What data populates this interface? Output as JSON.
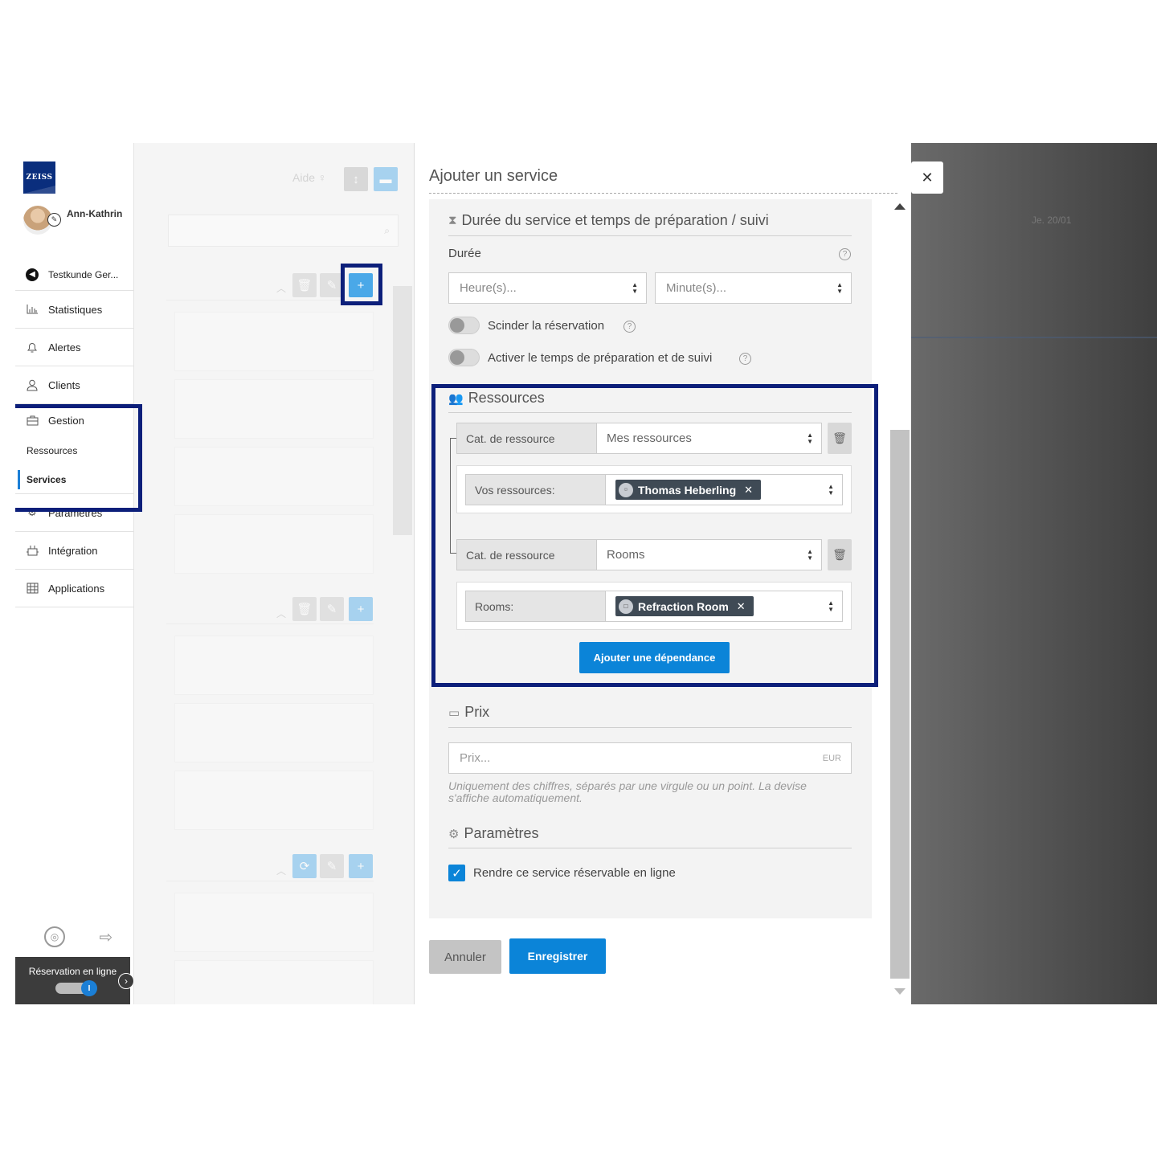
{
  "sidebar": {
    "logo": "ZEISS",
    "user_name": "Ann-Kathrin",
    "items": [
      {
        "label": "Testkunde Ger...",
        "icon": "back-circle-icon"
      },
      {
        "label": "Statistiques",
        "icon": "bar-chart-icon"
      },
      {
        "label": "Alertes",
        "icon": "bell-icon"
      },
      {
        "label": "Clients",
        "icon": "user-icon"
      },
      {
        "label": "Gestion",
        "icon": "briefcase-icon"
      },
      {
        "label": "Paramètres",
        "icon": "gears-icon"
      },
      {
        "label": "Intégration",
        "icon": "plug-icon"
      },
      {
        "label": "Applications",
        "icon": "grid-icon"
      }
    ],
    "subitems": [
      {
        "label": "Ressources"
      },
      {
        "label": "Services",
        "active": true
      }
    ],
    "online_booking": "Réservation en ligne"
  },
  "list_pane": {
    "help_label": "Aide"
  },
  "calendar": {
    "date_label": "Je. 20/01"
  },
  "modal": {
    "title": "Ajouter un service",
    "duration_section": {
      "title": "Durée du service et temps de préparation / suivi",
      "duration_label": "Durée",
      "hours_placeholder": "Heure(s)...",
      "minutes_placeholder": "Minute(s)...",
      "split_booking": "Scinder la réservation",
      "enable_prep": "Activer le temps de préparation et de suivi"
    },
    "resources_section": {
      "title": "Ressources",
      "groups": [
        {
          "category_label": "Cat. de ressource",
          "category_value": "Mes ressources",
          "resource_label": "Vos ressources:",
          "tag": "Thomas Heberling"
        },
        {
          "category_label": "Cat. de ressource",
          "category_value": "Rooms",
          "resource_label": "Rooms:",
          "tag": "Refraction Room"
        }
      ],
      "add_dependency": "Ajouter une dépendance"
    },
    "price_section": {
      "title": "Prix",
      "placeholder": "Prix...",
      "currency": "EUR",
      "hint": "Uniquement des chiffres, séparés par une virgule ou un point. La devise s'affiche automatiquement."
    },
    "settings_section": {
      "title": "Paramètres",
      "bookable_online": "Rendre ce service réservable en ligne",
      "bookable_checked": true
    },
    "cancel_label": "Annuler",
    "save_label": "Enregistrer"
  },
  "colors": {
    "accent": "#0b84d8",
    "highlight_border": "#0c1f7a",
    "tag_bg": "#3f4a55"
  }
}
